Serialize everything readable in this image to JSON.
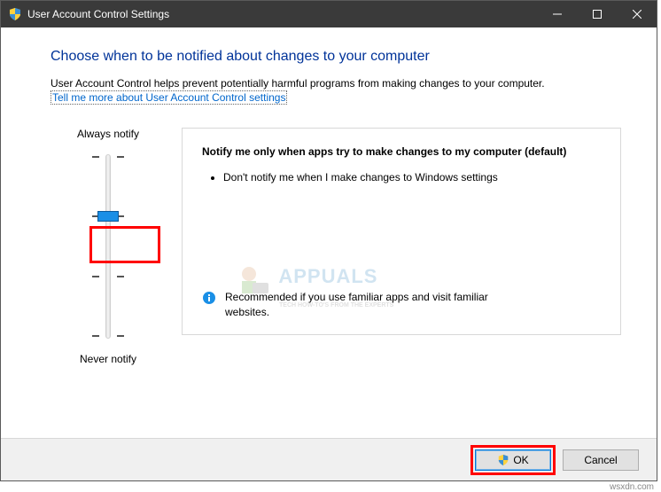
{
  "window": {
    "title": "User Account Control Settings"
  },
  "content": {
    "heading": "Choose when to be notified about changes to your computer",
    "subtext": "User Account Control helps prevent potentially harmful programs from making changes to your computer.",
    "link": "Tell me more about User Account Control settings"
  },
  "slider": {
    "top_label": "Always notify",
    "bottom_label": "Never notify",
    "levels": 4,
    "selected_level": 2
  },
  "panel": {
    "title": "Notify me only when apps try to make changes to my computer (default)",
    "item1": "Don't notify me when I make changes to Windows settings",
    "recommend": "Recommended if you use familiar apps and visit familiar websites."
  },
  "buttons": {
    "ok": "OK",
    "cancel": "Cancel"
  },
  "watermark": {
    "brand": "APPUALS",
    "tag": "TECH HOW-TO'S FROM THE EXPERTS"
  },
  "footnote": "wsxdn.com"
}
